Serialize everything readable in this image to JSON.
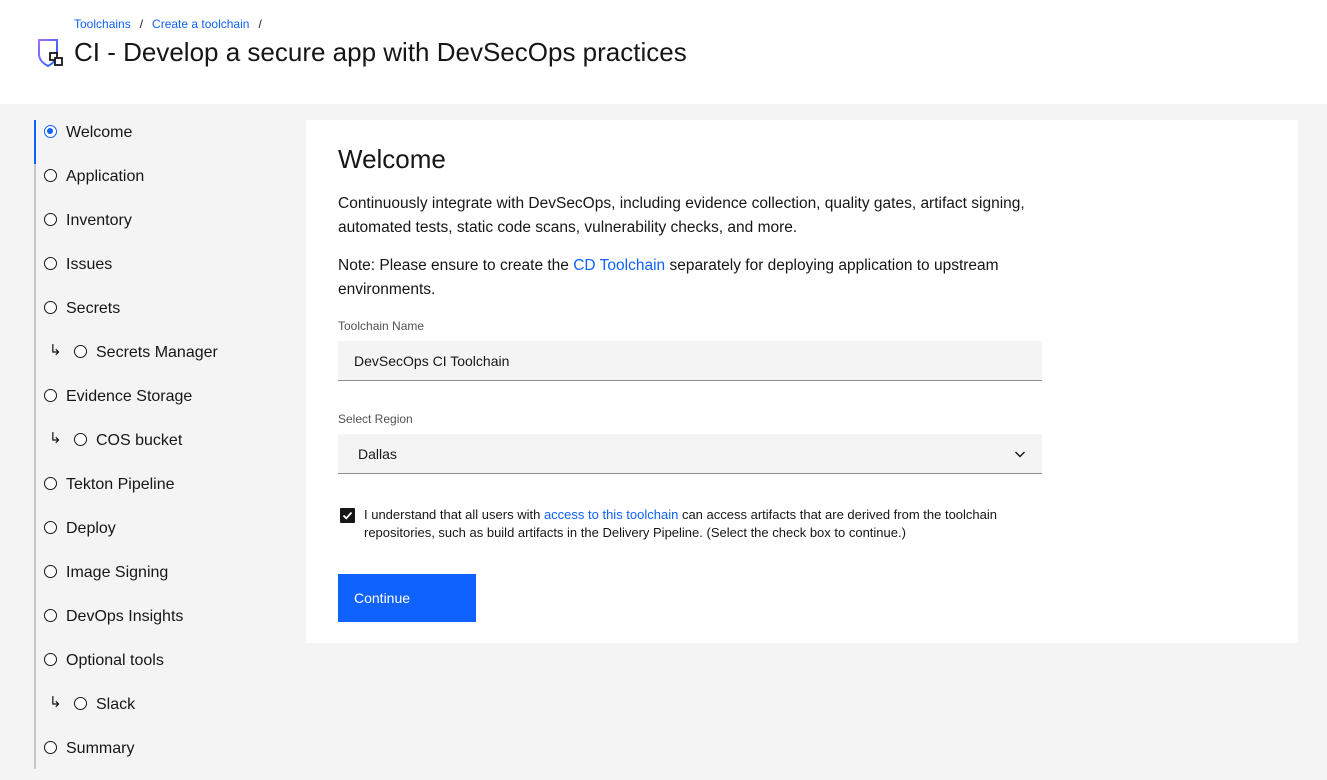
{
  "breadcrumb": {
    "items": [
      "Toolchains",
      "Create a toolchain"
    ],
    "separator": "/"
  },
  "header": {
    "title": "CI - Develop a secure app with DevSecOps practices",
    "icon": "toolchain-icon"
  },
  "steps": [
    {
      "label": "Welcome",
      "active": true,
      "sub": false
    },
    {
      "label": "Application",
      "active": false,
      "sub": false
    },
    {
      "label": "Inventory",
      "active": false,
      "sub": false
    },
    {
      "label": "Issues",
      "active": false,
      "sub": false
    },
    {
      "label": "Secrets",
      "active": false,
      "sub": false
    },
    {
      "label": "Secrets Manager",
      "active": false,
      "sub": true
    },
    {
      "label": "Evidence Storage",
      "active": false,
      "sub": false
    },
    {
      "label": "COS bucket",
      "active": false,
      "sub": true
    },
    {
      "label": "Tekton Pipeline",
      "active": false,
      "sub": false
    },
    {
      "label": "Deploy",
      "active": false,
      "sub": false
    },
    {
      "label": "Image Signing",
      "active": false,
      "sub": false
    },
    {
      "label": "DevOps Insights",
      "active": false,
      "sub": false
    },
    {
      "label": "Optional tools",
      "active": false,
      "sub": false
    },
    {
      "label": "Slack",
      "active": false,
      "sub": true
    },
    {
      "label": "Summary",
      "active": false,
      "sub": false
    }
  ],
  "main": {
    "title": "Welcome",
    "intro": "Continuously integrate with DevSecOps, including evidence collection, quality gates, artifact signing, automated tests, static code scans, vulnerability checks, and more.",
    "note": {
      "prefix": "Note: Please ensure to create the ",
      "link": "CD Toolchain",
      "suffix": " separately for deploying application to upstream environments."
    },
    "toolchain_name": {
      "label": "Toolchain Name",
      "value": "DevSecOps CI Toolchain"
    },
    "region": {
      "label": "Select Region",
      "value": "Dallas"
    },
    "consent": {
      "checked": true,
      "prefix": "I understand that all users with ",
      "link": "access to this toolchain",
      "suffix": " can access artifacts that are derived from the toolchain repositories, such as build artifacts in the Delivery Pipeline. (Select the check box to continue.)"
    },
    "continue_label": "Continue"
  },
  "colors": {
    "accent": "#0f62fe",
    "background": "#f4f4f4",
    "text": "#161616"
  }
}
